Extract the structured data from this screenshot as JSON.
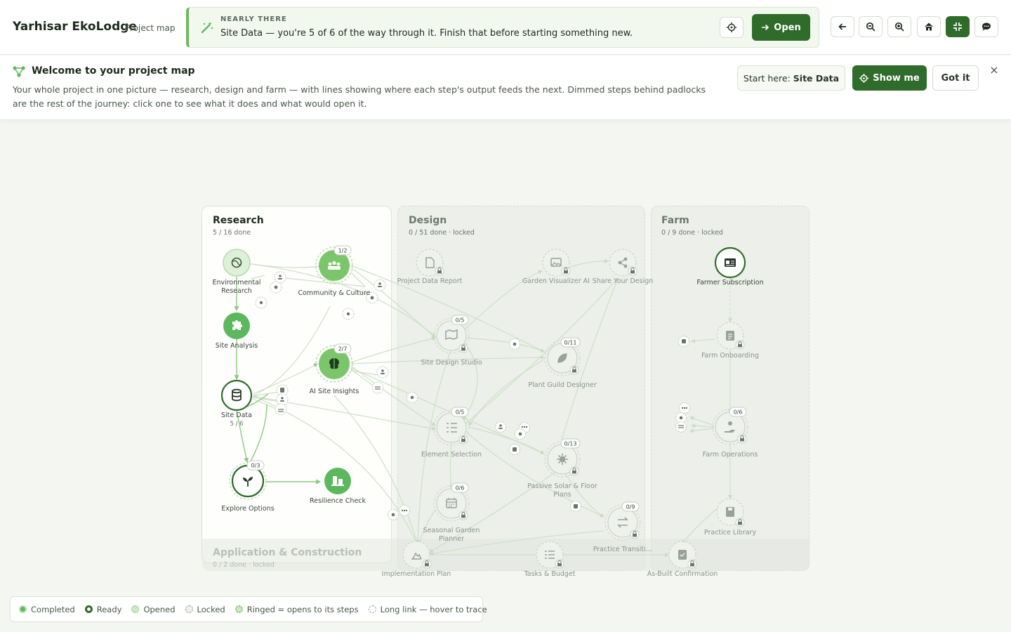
{
  "header": {
    "title": "Yarhisar EkoLodge",
    "subtitle": "Project map",
    "nudge": {
      "kicker": "NEARLY THERE",
      "text": "Site Data — you're 5 of 6 of the way through it. Finish that before starting something new.",
      "open_label": "Open"
    },
    "tools": [
      "back-icon",
      "zoom-out-icon",
      "zoom-in-icon",
      "home-icon",
      "fit-icon",
      "chat-icon"
    ]
  },
  "welcome": {
    "title": "Welcome to your project map",
    "body": "Your whole project in one picture — research, design and farm — with lines showing where each step's output feeds the next. Dimmed steps behind padlocks are the rest of the journey: click one to see what it does and what would open it.",
    "start_here_prefix": "Start here:",
    "start_here_target": "Site Data",
    "show_me_label": "Show me",
    "got_it_label": "Got it",
    "close_label": "×"
  },
  "regions": {
    "research": {
      "title": "Research",
      "sub": "5 / 16 done"
    },
    "design": {
      "title": "Design",
      "sub": "0 / 51 done · locked"
    },
    "farm": {
      "title": "Farm",
      "sub": "0 / 9 done · locked"
    },
    "app": {
      "title": "Application & Construction",
      "sub": "0 / 2 done · locked"
    }
  },
  "nodes": {
    "env": {
      "label": "Environmental Research"
    },
    "community": {
      "label": "Community & Culture",
      "badge": "1/2"
    },
    "site_analysis": {
      "label": "Site Analysis"
    },
    "ai_insights": {
      "label": "AI Site Insights",
      "badge": "2/7"
    },
    "site_data": {
      "label": "Site Data",
      "progress": "5 / 6"
    },
    "explore": {
      "label": "Explore Options",
      "badge": "0/3"
    },
    "resilience": {
      "label": "Resilience Check"
    },
    "project_report": {
      "label": "Project Data Report"
    },
    "garden_viz": {
      "label": "Garden Visualizer AI"
    },
    "share_design": {
      "label": "Share Your Design"
    },
    "site_design": {
      "label": "Site Design Studio",
      "badge": "0/5"
    },
    "plant_guild": {
      "label": "Plant Guild Designer",
      "badge": "0/11"
    },
    "element_sel": {
      "label": "Element Selection",
      "badge": "0/5"
    },
    "passive_solar": {
      "label": "Passive Solar & Floor Plans",
      "badge": "0/13"
    },
    "seasonal": {
      "label": "Seasonal Garden Planner",
      "badge": "0/6"
    },
    "practice_trans": {
      "label": "Practice Transiti…",
      "badge": "0/9"
    },
    "implementation": {
      "label": "Implementation Plan"
    },
    "tasks_budget": {
      "label": "Tasks & Budget"
    },
    "as_built": {
      "label": "As-Built Confirmation"
    },
    "farmer_sub": {
      "label": "Farmer Subscription"
    },
    "farm_onboard": {
      "label": "Farm Onboarding"
    },
    "farm_ops": {
      "label": "Farm Operations",
      "badge": "0/6"
    },
    "practice_lib": {
      "label": "Practice Library"
    }
  },
  "legend": [
    {
      "label": "Completed",
      "kind": "completed"
    },
    {
      "label": "Ready",
      "kind": "ready"
    },
    {
      "label": "Opened",
      "kind": "opened"
    },
    {
      "label": "Locked",
      "kind": "locked"
    },
    {
      "label": "Ringed = opens to its steps",
      "kind": "ringed"
    },
    {
      "label": "Long link — hover to trace",
      "kind": "long"
    }
  ],
  "colors": {
    "brand": "#2f6b2a",
    "completed": "#5cb85c",
    "opened": "#cfe7c9",
    "locked": "#e6eae3",
    "link": "#c9dcc2"
  }
}
